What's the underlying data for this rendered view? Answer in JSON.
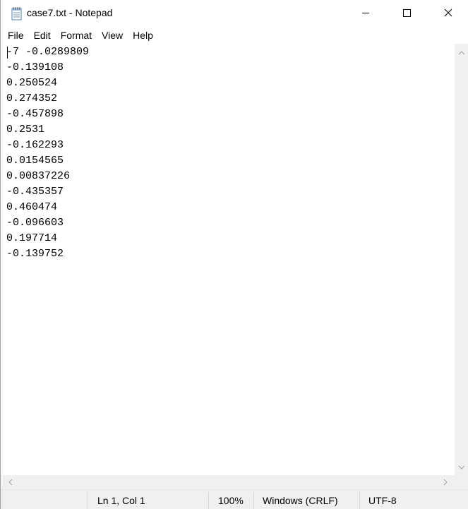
{
  "window": {
    "title": "case7.txt - Notepad"
  },
  "icons": {
    "app": "notepad-icon",
    "minimize": "minimize-icon",
    "maximize": "maximize-icon",
    "close": "close-icon"
  },
  "menu": {
    "items": [
      {
        "label": "File"
      },
      {
        "label": "Edit"
      },
      {
        "label": "Format"
      },
      {
        "label": "View"
      },
      {
        "label": "Help"
      }
    ]
  },
  "editor": {
    "lines": [
      "-7 -0.0289809",
      "-0.139108",
      "0.250524",
      "0.274352",
      "-0.457898",
      "0.2531",
      "-0.162293",
      "0.0154565",
      "0.00837226",
      "-0.435357",
      "0.460474",
      "-0.096603",
      "0.197714",
      "-0.139752"
    ]
  },
  "status": {
    "position": "Ln 1, Col 1",
    "zoom": "100%",
    "line_ending": "Windows (CRLF)",
    "encoding": "UTF-8"
  },
  "colors": {
    "chrome": "#f0f0f0",
    "text": "#000000",
    "editor_bg": "#ffffff"
  }
}
